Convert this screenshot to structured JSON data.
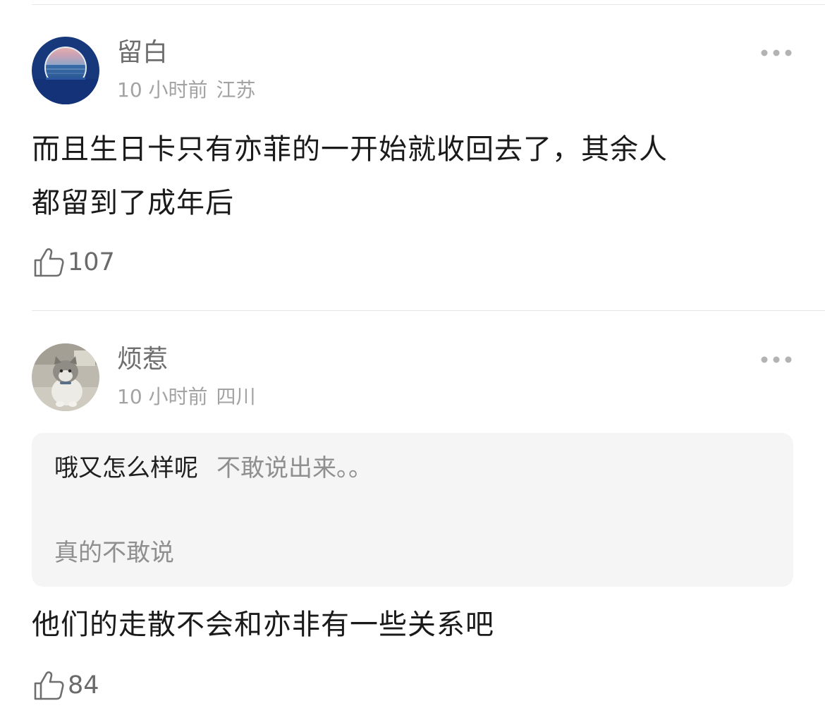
{
  "comments": [
    {
      "username": "留白",
      "time": "10 小时前",
      "location": "江苏",
      "content_lines": [
        "而且生日卡只有亦菲的一开始就收回去了，其余人",
        "都留到了成年后"
      ],
      "likes": "107",
      "avatar_icon": "sunset-sea-icon"
    },
    {
      "username": "烦惹",
      "time": "10 小时前",
      "location": "四川",
      "quote": {
        "author": "哦又怎么样呢",
        "text": "不敢说出来。。",
        "second_line": "真的不敢说"
      },
      "content_lines": [
        "他们的走散不会和亦非有一些关系吧"
      ],
      "likes": "84",
      "avatar_icon": "cat-photo-icon"
    }
  ],
  "icons": {
    "more": "more-dots-icon",
    "like": "thumbs-up-icon"
  },
  "colors": {
    "username": "#6e6e6e",
    "meta": "#a3a3a3",
    "quote_background": "#f5f5f5",
    "divider": "#e6e6e6"
  }
}
